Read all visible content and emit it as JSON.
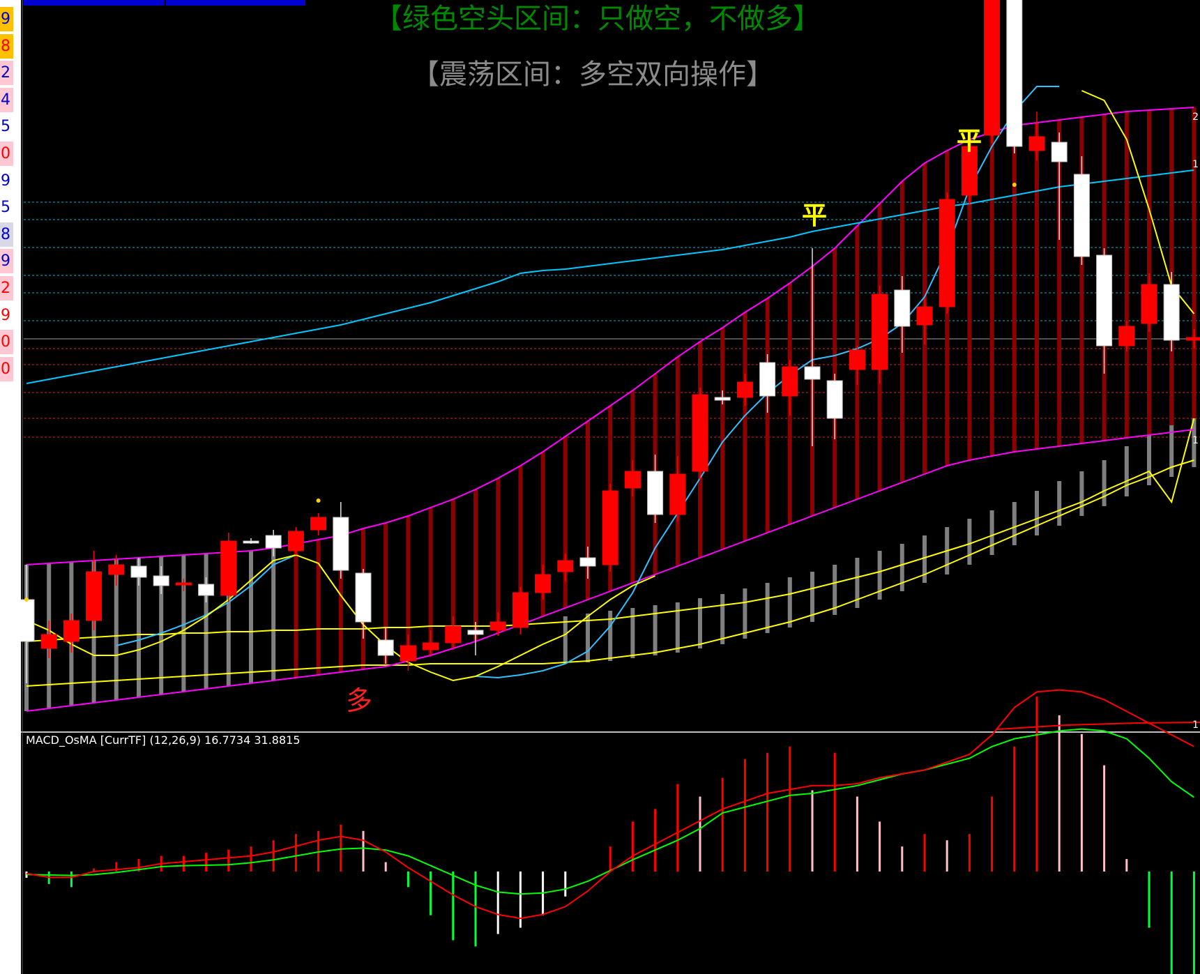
{
  "left_strip": {
    "cells": [
      {
        "text": "9",
        "color": "#0000cc",
        "bg": "#ffc000"
      },
      {
        "text": "8",
        "color": "#ff0000",
        "bg": "#ffc000"
      },
      {
        "text": "2",
        "color": "#0000cc",
        "bg": "#ffc8d2"
      },
      {
        "text": "4",
        "color": "#0000cc",
        "bg": "#ffc8d2"
      },
      {
        "text": "5",
        "color": "#0000cc",
        "bg": "#ffffff"
      },
      {
        "text": "0",
        "color": "#ff0000",
        "bg": "#ffc8d2"
      },
      {
        "text": "9",
        "color": "#0000cc",
        "bg": "#ffffff"
      },
      {
        "text": "5",
        "color": "#0000cc",
        "bg": "#ffffff"
      },
      {
        "text": "8",
        "color": "#0000cc",
        "bg": "#d8d8e8"
      },
      {
        "text": "9",
        "color": "#0000cc",
        "bg": "#ffc8d2"
      },
      {
        "text": "2",
        "color": "#ff0000",
        "bg": "#ffc8d2"
      },
      {
        "text": "9",
        "color": "#ff0000",
        "bg": "#ffffff"
      },
      {
        "text": "0",
        "color": "#ff0000",
        "bg": "#ffc8d2"
      },
      {
        "text": "0",
        "color": "#ff0000",
        "bg": "#ffc8d2"
      }
    ]
  },
  "titles": {
    "bear_zone": "【绿色空头区间：只做空，不做多】",
    "range_zone": "【震荡区间：多空双向操作】"
  },
  "signals": {
    "long": "多",
    "close1": "平",
    "close2": "平"
  },
  "macd_indicator": {
    "label": "MACD_OsMA [CurrTF] (12,26,9) 16.7734 31.8815"
  },
  "right_axis": {
    "ticks": [
      {
        "text": "2"
      },
      {
        "text": "1"
      },
      {
        "text": "1"
      },
      {
        "text": "1"
      }
    ]
  },
  "colors": {
    "background": "#000000",
    "up_candle": "#ff0000",
    "down_candle": "#ffffff",
    "band": "#ff00ff",
    "ma_long": "#00c8ff",
    "ma_short": "#33c0ff",
    "yellow": "#ffff00",
    "hist_dark_red": "#8b0000",
    "hist_gray": "#7f7f7f",
    "macd_red": "#ff0000",
    "macd_green": "#00ff00",
    "title_green": "#008800",
    "title_gray": "#888888"
  },
  "chart_data": {
    "type": "candlestick",
    "candles": [
      {
        "o": 430,
        "c": 460,
        "h": 405,
        "l": 490,
        "up": false
      },
      {
        "o": 465,
        "c": 455,
        "h": 445,
        "l": 472,
        "up": true
      },
      {
        "o": 460,
        "c": 445,
        "h": 440,
        "l": 468,
        "up": true
      },
      {
        "o": 445,
        "c": 410,
        "h": 395,
        "l": 452,
        "up": true
      },
      {
        "o": 412,
        "c": 405,
        "h": 398,
        "l": 420,
        "up": true
      },
      {
        "o": 406,
        "c": 414,
        "h": 400,
        "l": 420,
        "up": false
      },
      {
        "o": 413,
        "c": 420,
        "h": 406,
        "l": 426,
        "up": false
      },
      {
        "o": 418,
        "c": 418,
        "h": 415,
        "l": 424,
        "up": true
      },
      {
        "o": 419,
        "c": 427,
        "h": 414,
        "l": 432,
        "up": false
      },
      {
        "o": 427,
        "c": 388,
        "h": 382,
        "l": 432,
        "up": true
      },
      {
        "o": 388,
        "c": 388,
        "h": 386,
        "l": 390,
        "up": false
      },
      {
        "o": 384,
        "c": 393,
        "h": 380,
        "l": 399,
        "up": false
      },
      {
        "o": 395,
        "c": 381,
        "h": 378,
        "l": 398,
        "up": true
      },
      {
        "o": 380,
        "c": 371,
        "h": 368,
        "l": 384,
        "up": true
      },
      {
        "o": 371,
        "c": 409,
        "h": 360,
        "l": 415,
        "up": false
      },
      {
        "o": 411,
        "c": 446,
        "h": 408,
        "l": 458,
        "up": false
      },
      {
        "o": 459,
        "c": 470,
        "h": 450,
        "l": 476,
        "up": false
      },
      {
        "o": 474,
        "c": 463,
        "h": 455,
        "l": 481,
        "up": true
      },
      {
        "o": 466,
        "c": 461,
        "h": 452,
        "l": 471,
        "up": true
      },
      {
        "o": 461,
        "c": 449,
        "h": 442,
        "l": 466,
        "up": true
      },
      {
        "o": 452,
        "c": 455,
        "h": 446,
        "l": 470,
        "up": false
      },
      {
        "o": 452,
        "c": 446,
        "h": 439,
        "l": 456,
        "up": true
      },
      {
        "o": 450,
        "c": 425,
        "h": 421,
        "l": 455,
        "up": true
      },
      {
        "o": 425,
        "c": 412,
        "h": 405,
        "l": 430,
        "up": true
      },
      {
        "o": 410,
        "c": 402,
        "h": 397,
        "l": 417,
        "up": true
      },
      {
        "o": 400,
        "c": 406,
        "h": 392,
        "l": 415,
        "up": false
      },
      {
        "o": 405,
        "c": 352,
        "h": 347,
        "l": 410,
        "up": true
      },
      {
        "o": 350,
        "c": 338,
        "h": 330,
        "l": 356,
        "up": true
      },
      {
        "o": 338,
        "c": 369,
        "h": 326,
        "l": 375,
        "up": false
      },
      {
        "o": 369,
        "c": 340,
        "h": 327,
        "l": 374,
        "up": true
      },
      {
        "o": 338,
        "c": 283,
        "h": 278,
        "l": 344,
        "up": true
      },
      {
        "o": 285,
        "c": 287,
        "h": 280,
        "l": 290,
        "up": false
      },
      {
        "o": 285,
        "c": 274,
        "h": 268,
        "l": 291,
        "up": true
      },
      {
        "o": 260,
        "c": 284,
        "h": 254,
        "l": 296,
        "up": false
      },
      {
        "o": 284,
        "c": 263,
        "h": 258,
        "l": 298,
        "up": true
      },
      {
        "o": 263,
        "c": 272,
        "h": 178,
        "l": 320,
        "up": false
      },
      {
        "o": 273,
        "c": 300,
        "h": 268,
        "l": 315,
        "up": false
      },
      {
        "o": 265,
        "c": 251,
        "h": 248,
        "l": 276,
        "up": true
      },
      {
        "o": 265,
        "c": 211,
        "h": 205,
        "l": 275,
        "up": true
      },
      {
        "o": 208,
        "c": 234,
        "h": 198,
        "l": 253,
        "up": false
      },
      {
        "o": 233,
        "c": 220,
        "h": 214,
        "l": 247,
        "up": true
      },
      {
        "o": 220,
        "c": 143,
        "h": 138,
        "l": 225,
        "up": true
      },
      {
        "o": 140,
        "c": 105,
        "h": 100,
        "l": 147,
        "up": true
      },
      {
        "o": -60,
        "c": 97,
        "h": -70,
        "l": 103,
        "up": true
      },
      {
        "o": -60,
        "c": 105,
        "h": -70,
        "l": 110,
        "up": false
      },
      {
        "o": 108,
        "c": 98,
        "h": 80,
        "l": 115,
        "up": true
      },
      {
        "o": 102,
        "c": 116,
        "h": 95,
        "l": 172,
        "up": false
      },
      {
        "o": 125,
        "c": 184,
        "h": 112,
        "l": 190,
        "up": false
      },
      {
        "o": 183,
        "c": 248,
        "h": 178,
        "l": 268,
        "up": false
      },
      {
        "o": 248,
        "c": 234,
        "h": 230,
        "l": 252,
        "up": true
      },
      {
        "o": 232,
        "c": 204,
        "h": 196,
        "l": 238,
        "up": true
      },
      {
        "o": 204,
        "c": 244,
        "h": 195,
        "l": 252,
        "up": false
      },
      {
        "o": 244,
        "c": 242,
        "h": 236,
        "l": 250,
        "up": true
      }
    ],
    "band_upper": [
      405,
      404,
      403,
      402,
      401,
      400,
      399,
      398,
      397,
      396,
      395,
      393,
      390,
      387,
      384,
      379,
      375,
      370,
      364,
      358,
      351,
      343,
      334,
      324,
      313,
      302,
      291,
      280,
      268,
      256,
      245,
      235,
      224,
      214,
      203,
      191,
      178,
      162,
      146,
      130,
      117,
      108,
      100,
      95,
      90,
      88,
      86,
      84,
      82,
      80,
      79,
      78,
      77
    ],
    "band_lower": [
      510,
      508,
      506,
      504,
      502,
      500,
      498,
      496,
      494,
      492,
      490,
      488,
      486,
      484,
      482,
      480,
      478,
      474,
      470,
      465,
      460,
      454,
      448,
      442,
      436,
      430,
      424,
      418,
      412,
      406,
      400,
      394,
      388,
      382,
      376,
      370,
      364,
      358,
      352,
      346,
      340,
      334,
      330,
      327,
      324,
      322,
      320,
      318,
      316,
      314,
      312,
      310,
      308
    ],
    "ma_long": [
      275,
      272,
      269,
      266,
      263,
      260,
      257,
      254,
      251,
      248,
      245,
      242,
      239,
      236,
      233,
      229,
      225,
      221,
      217,
      212,
      207,
      202,
      196,
      194,
      193,
      191,
      189,
      187,
      185,
      183,
      181,
      179,
      176,
      173,
      170,
      166,
      163,
      160,
      157,
      154,
      151,
      148,
      146,
      143,
      140,
      137,
      134,
      132,
      130,
      128,
      126,
      124,
      122
    ],
    "ma_short": [
      null,
      null,
      null,
      null,
      463,
      459,
      454,
      448,
      441,
      432,
      420,
      405,
      398,
      null,
      null,
      null,
      null,
      null,
      null,
      null,
      485,
      486,
      484,
      481,
      476,
      467,
      449,
      425,
      393,
      368,
      343,
      317,
      298,
      282,
      269,
      258,
      255,
      250,
      243,
      232,
      213,
      179,
      135,
      105,
      80,
      62,
      62,
      null,
      null,
      null,
      null,
      null,
      null
    ],
    "yellow_lower": [
      492,
      491,
      490,
      489,
      488,
      487,
      486,
      485,
      484,
      483,
      482,
      481,
      480,
      479,
      478,
      477,
      477,
      477,
      476,
      476,
      476,
      476,
      476,
      476,
      475,
      474,
      472,
      470,
      468,
      465,
      462,
      458,
      454,
      450,
      446,
      441,
      436,
      430,
      424,
      418,
      412,
      405,
      398,
      391,
      384,
      377,
      370,
      363,
      356,
      348,
      342,
      335,
      330
    ],
    "yellow_upper": [
      460,
      459,
      458,
      457,
      456,
      455,
      455,
      454,
      454,
      453,
      453,
      452,
      452,
      451,
      451,
      451,
      450,
      450,
      449,
      449,
      449,
      449,
      448,
      447,
      446,
      445,
      444,
      442,
      440,
      438,
      436,
      434,
      432,
      429,
      426,
      422,
      418,
      414,
      410,
      405,
      400,
      395,
      390,
      384,
      378,
      372,
      366,
      360,
      352,
      345,
      338,
      360,
      300
    ],
    "gray_hist_top": [
      405,
      404,
      403,
      402,
      401,
      400,
      399,
      398,
      397,
      396,
      395,
      393,
      null,
      null,
      null,
      null,
      null,
      null,
      null,
      null,
      null,
      null,
      null,
      null,
      442,
      440,
      438,
      436,
      434,
      432,
      429,
      426,
      422,
      418,
      414,
      410,
      405,
      400,
      395,
      390,
      384,
      378,
      372,
      366,
      360,
      352,
      345,
      338,
      330,
      320,
      312,
      305,
      300
    ],
    "gray_hist_bottom": [
      510,
      508,
      506,
      504,
      502,
      500,
      498,
      496,
      494,
      492,
      490,
      488,
      null,
      null,
      null,
      null,
      null,
      null,
      null,
      null,
      null,
      null,
      null,
      null,
      476,
      475,
      474,
      472,
      470,
      468,
      465,
      462,
      458,
      454,
      450,
      446,
      441,
      436,
      430,
      424,
      418,
      412,
      405,
      398,
      391,
      384,
      377,
      370,
      363,
      356,
      348,
      342,
      335
    ],
    "yellow_short": [
      445,
      452,
      462,
      470,
      470,
      466,
      460,
      452,
      442,
      430,
      416,
      402,
      398,
      404,
      427,
      448,
      463,
      475,
      482,
      488,
      485,
      478,
      470,
      462,
      455,
      442,
      430,
      420,
      413,
      null,
      null,
      null,
      null,
      null,
      null,
      null,
      null,
      null,
      null,
      null,
      null,
      null,
      null,
      null,
      null,
      null,
      null,
      65,
      72,
      100,
      150,
      205,
      225
    ],
    "macd_hist": [
      -2,
      -4,
      -5,
      1,
      3,
      4,
      5,
      5,
      6,
      7,
      8,
      10,
      12,
      13,
      15,
      13,
      3,
      -5,
      -14,
      -22,
      -24,
      -20,
      -18,
      -14,
      -8,
      0,
      8,
      16,
      20,
      28,
      24,
      30,
      36,
      38,
      40,
      26,
      38,
      24,
      16,
      8,
      12,
      10,
      12,
      24,
      40,
      56,
      50,
      44,
      34,
      4,
      -18,
      -40,
      -42
    ],
    "macd_signal": [
      -1.5,
      -1.8,
      -2.0,
      -1.6,
      -0.5,
      1.0,
      2.5,
      3.0,
      3.2,
      3.5,
      4.5,
      6.0,
      8.0,
      10.0,
      11.5,
      12.0,
      11.0,
      8.0,
      3.0,
      -2.0,
      -7.0,
      -10.5,
      -11.5,
      -11.0,
      -9.0,
      -5.0,
      0.5,
      6.0,
      11.0,
      16.0,
      22.0,
      30.0,
      33.0,
      36.0,
      39.0,
      40.0,
      42.0,
      44.0,
      47.0,
      50.0,
      52.0,
      55.0,
      58.0,
      64.0,
      68.0,
      70.0,
      72.0,
      73.0,
      72.0,
      68.0,
      58.0,
      46.0,
      38.0
    ],
    "macd_main": [
      -1,
      -3,
      -3,
      0,
      1,
      2,
      4,
      5,
      6,
      7,
      8,
      10,
      13,
      16,
      18,
      16,
      10,
      2,
      -5,
      -12,
      -18,
      -22,
      -24,
      -22,
      -18,
      -10,
      0,
      8,
      14,
      20,
      26,
      32,
      36,
      40,
      42,
      44,
      44,
      45,
      48,
      50,
      52,
      56,
      60,
      70,
      84,
      92,
      93,
      92,
      88,
      82,
      76,
      70,
      64
    ]
  }
}
